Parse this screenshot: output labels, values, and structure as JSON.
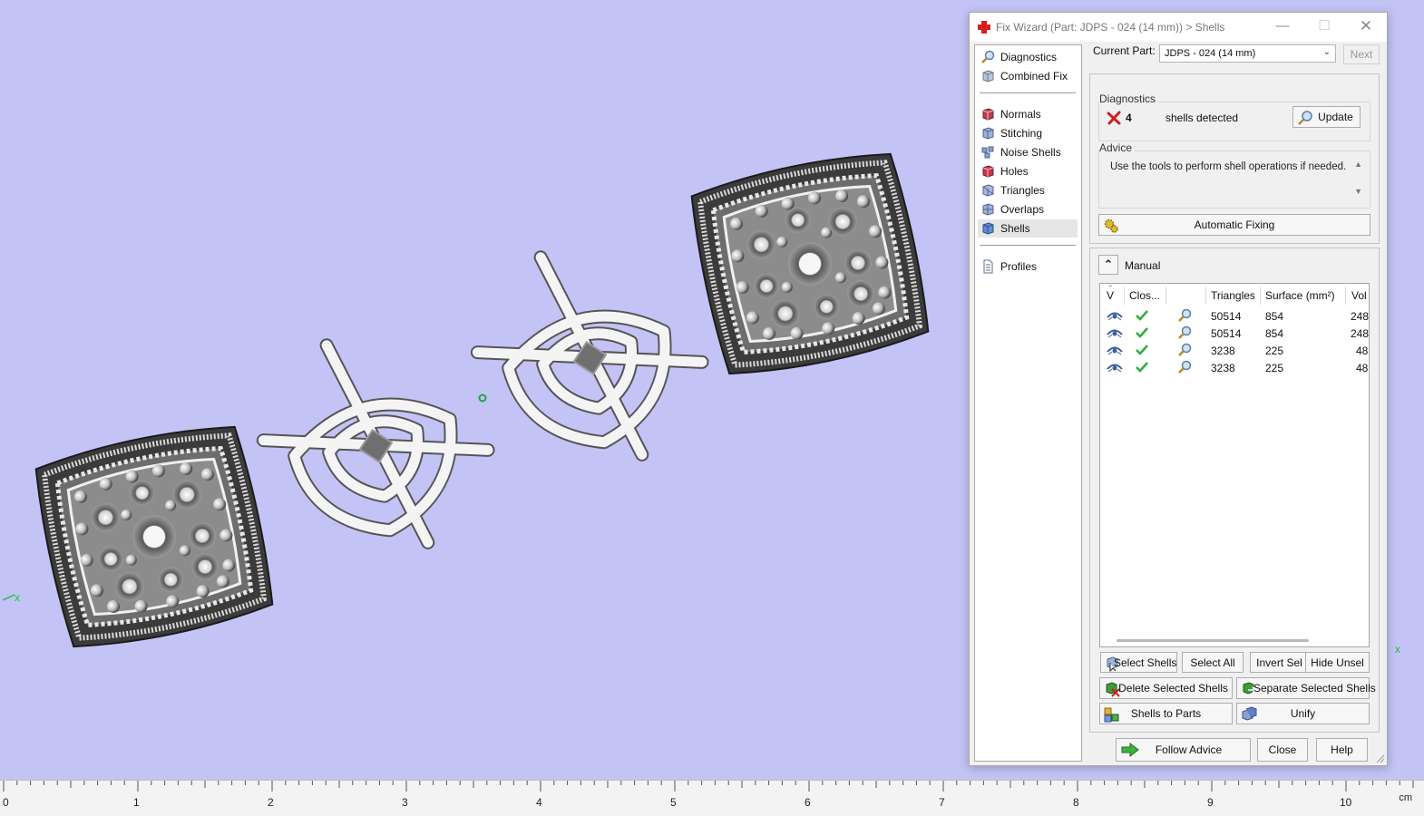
{
  "dialog": {
    "title": "Fix Wizard (Part: JDPS - 024 (14 mm)) > Shells",
    "window_controls": {
      "minimize": "—",
      "maximize": "☐",
      "close": "✕"
    }
  },
  "nav": {
    "items": [
      {
        "label": "Diagnostics",
        "icon": "magnifier-icon"
      },
      {
        "label": "Combined Fix",
        "icon": "cube-icon"
      },
      {
        "label": "Normals",
        "icon": "normals-icon"
      },
      {
        "label": "Stitching",
        "icon": "stitching-icon"
      },
      {
        "label": "Noise Shells",
        "icon": "noise-shells-icon"
      },
      {
        "label": "Holes",
        "icon": "holes-icon"
      },
      {
        "label": "Triangles",
        "icon": "triangles-icon"
      },
      {
        "label": "Overlaps",
        "icon": "overlaps-icon"
      },
      {
        "label": "Shells",
        "icon": "shells-icon",
        "active": true
      },
      {
        "label": "Profiles",
        "icon": "document-icon"
      }
    ]
  },
  "current_part": {
    "label": "Current Part:",
    "value": "JDPS - 024 (14 mm)",
    "next_label": "Next"
  },
  "diagnostics": {
    "title": "Diagnostics",
    "count": "4",
    "text": "shells detected",
    "update_label": "Update"
  },
  "advice": {
    "title": "Advice",
    "text": "Use the tools to perform shell operations if needed."
  },
  "automatic_fixing_label": "Automatic Fixing",
  "manual": {
    "title": "Manual",
    "columns": [
      "V",
      "Clos...",
      "",
      "Triangles",
      "Surface (mm²)",
      "Vol"
    ],
    "rows": [
      {
        "triangles": "50514",
        "surface": "854",
        "volume": "248"
      },
      {
        "triangles": "50514",
        "surface": "854",
        "volume": "248"
      },
      {
        "triangles": "3238",
        "surface": "225",
        "volume": "48"
      },
      {
        "triangles": "3238",
        "surface": "225",
        "volume": "48"
      }
    ],
    "buttons": {
      "select_shells": "Select Shells",
      "select_all": "Select All",
      "invert_sel": "Invert Sel",
      "hide_unsel": "Hide Unsel",
      "delete_selected": "Delete Selected Shells",
      "separate_selected": "Separate Selected Shells",
      "shells_to_parts": "Shells to Parts",
      "unify": "Unify"
    }
  },
  "footer": {
    "follow_advice": "Follow Advice",
    "close": "Close",
    "help": "Help"
  },
  "ruler": {
    "labels": [
      "0",
      "1",
      "2",
      "3",
      "4",
      "5",
      "6",
      "7",
      "8",
      "9",
      "10"
    ],
    "unit": "cm"
  },
  "viewport": {
    "axis_label_left": "x",
    "axis_label_right": "x"
  },
  "colors": {
    "viewport_bg": "#c4c3f6",
    "accent_green": "#2fae3c",
    "error_red": "#d02020",
    "title_icon_red": "#d62020"
  }
}
